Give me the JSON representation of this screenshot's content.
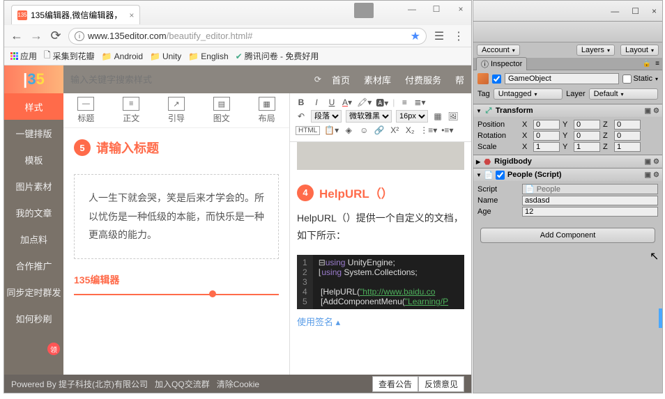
{
  "browser": {
    "tab_title": "135编辑器,微信编辑器，",
    "url_host": "www.135editor.com",
    "url_path": "/beautify_editor.html#",
    "bookmarks": {
      "apps": "应用",
      "b1": "采集到花瓣",
      "b2": "Android",
      "b3": "Unity",
      "b4": "English",
      "b5": "腾讯问卷 - 免费好用"
    }
  },
  "editor": {
    "search_placeholder": "输入关键字搜索样式",
    "nav": {
      "home": "首页",
      "materials": "素材库",
      "paid": "付费服务",
      "help": "帮"
    },
    "sidebar": {
      "style": "样式",
      "layout1": "一键排版",
      "template": "模板",
      "pic": "图片素材",
      "myarticle": "我的文章",
      "addon": "加点料",
      "coop": "合作推广",
      "sync": "同步定时群发",
      "brush": "如何秒刷"
    },
    "tools": {
      "title": "标题",
      "text": "正文",
      "quote": "引导",
      "imgtxt": "图文",
      "layout": "布局"
    },
    "badge5": "5",
    "input_title": "请输入标题",
    "quote_text": "人一生下就会哭，笑是后来才学会的。所以忧伤是一种低级的本能，而快乐是一种更高级的能力。",
    "divider": "135编辑器",
    "rt": {
      "para": "段落",
      "font": "微软雅黑",
      "size": "16px"
    },
    "article": {
      "badge4": "4",
      "heading": "HelpURL（）",
      "body": "HelpURL（）提供一个自定义的文档，如下所示：",
      "code_lines": [
        "1",
        "2",
        "3",
        "4",
        "5"
      ],
      "code": "⊟using UnityEngine;\n⌊using System.Collections;\n\n [HelpURL(\"http://www.baidu.co\n [AddComponentMenu(\"Learning/P",
      "sign": "使用签名 "
    },
    "footer": {
      "powered": "Powered By 提子科技(北京)有限公司",
      "qq": "加入QQ交流群",
      "cookie": "清除Cookie",
      "notice": "查看公告",
      "feedback": "反馈意见"
    }
  },
  "unity": {
    "toolbar": {
      "account": "Account",
      "layers": "Layers",
      "layout": "Layout"
    },
    "inspector": "Inspector",
    "go_name": "GameObject",
    "static": "Static",
    "tag_label": "Tag",
    "tag_value": "Untagged",
    "layer_label": "Layer",
    "layer_value": "Default",
    "transform": {
      "title": "Transform",
      "position": "Position",
      "rotation": "Rotation",
      "scale": "Scale",
      "px": "0",
      "py": "0",
      "pz": "0",
      "rx": "0",
      "ry": "0",
      "rz": "0",
      "sx": "1",
      "sy": "1",
      "sz": "1"
    },
    "rigidbody": "Rigidbody",
    "people": {
      "title": "People (Script)",
      "script_label": "Script",
      "script_value": "People",
      "name_label": "Name",
      "name_value": "asdasd",
      "age_label": "Age",
      "age_value": "12"
    },
    "add_component": "Add Component"
  }
}
